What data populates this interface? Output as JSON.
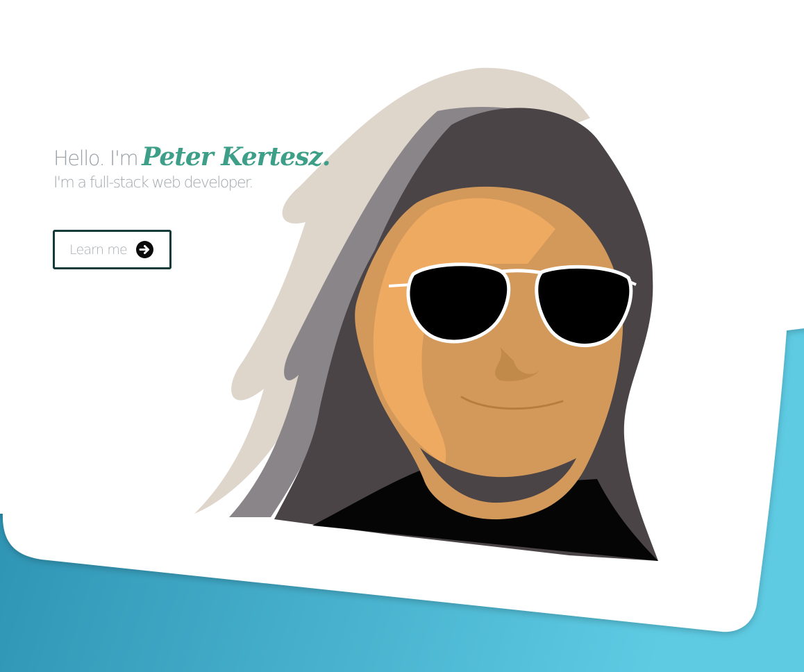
{
  "hero": {
    "greeting": "Hello. I'm",
    "name": "Peter Kertesz.",
    "tagline": "I'm a full-stack web developer.",
    "cta": {
      "label": "Learn me",
      "icon": "arrow-circle-right-icon"
    }
  },
  "colors": {
    "accent_name": "#3e9f88",
    "button_border": "#123a38",
    "gradient_start": "#2a8fb0",
    "gradient_end": "#5cc6e0"
  }
}
